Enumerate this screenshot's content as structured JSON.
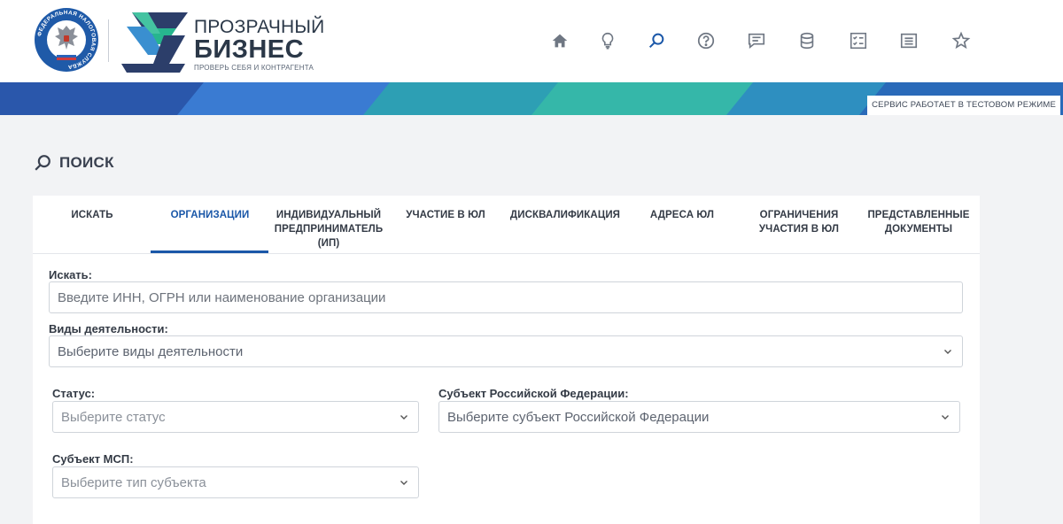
{
  "header": {
    "fns_logo_text": "ФЕДЕРАЛЬНАЯ НАЛОГОВАЯ СЛУЖБА",
    "brand": {
      "line1": "ПРОЗРАЧНЫЙ",
      "line2": "БИЗНЕС",
      "tagline": "ПРОВЕРЬ СЕБЯ И КОНТРАГЕНТА"
    },
    "nav_icons": [
      "home-icon",
      "lightbulb-icon",
      "search-icon",
      "question-icon",
      "chat-icon",
      "database-icon",
      "checklist-icon",
      "list-icon",
      "star-icon"
    ],
    "accent_color": "#1a57a8"
  },
  "banner": {
    "test_mode_label": "СЕРВИС РАБОТАЕТ В ТЕСТОВОМ РЕЖИМЕ"
  },
  "page": {
    "title": "ПОИСК"
  },
  "tabs": [
    {
      "label": "ИСКАТЬ"
    },
    {
      "label": "ОРГАНИЗАЦИИ",
      "active": true
    },
    {
      "label": "ИНДИВИДУАЛЬНЫЙ ПРЕДПРИНИМАТЕЛЬ (ИП)"
    },
    {
      "label": "УЧАСТИЕ В ЮЛ"
    },
    {
      "label": "ДИСКВАЛИФИКАЦИЯ"
    },
    {
      "label": "АДРЕСА ЮЛ"
    },
    {
      "label": "ОГРАНИЧЕНИЯ УЧАСТИЯ В ЮЛ"
    },
    {
      "label": "ПРЕДСТАВЛЕННЫЕ ДОКУМЕНТЫ"
    }
  ],
  "form": {
    "search": {
      "label": "Искать:",
      "placeholder": "Введите ИНН, ОГРН или наименование организации",
      "value": ""
    },
    "activities": {
      "label": "Виды деятельности:",
      "placeholder": "Выберите виды деятельности"
    },
    "status": {
      "label": "Статус:",
      "placeholder": "Выберите статус"
    },
    "region": {
      "label": "Субъект Российской Федерации:",
      "placeholder": "Выберите субъект Российской Федерации"
    },
    "msp": {
      "label": "Субъект МСП:",
      "placeholder": "Выберите тип субъекта"
    }
  }
}
